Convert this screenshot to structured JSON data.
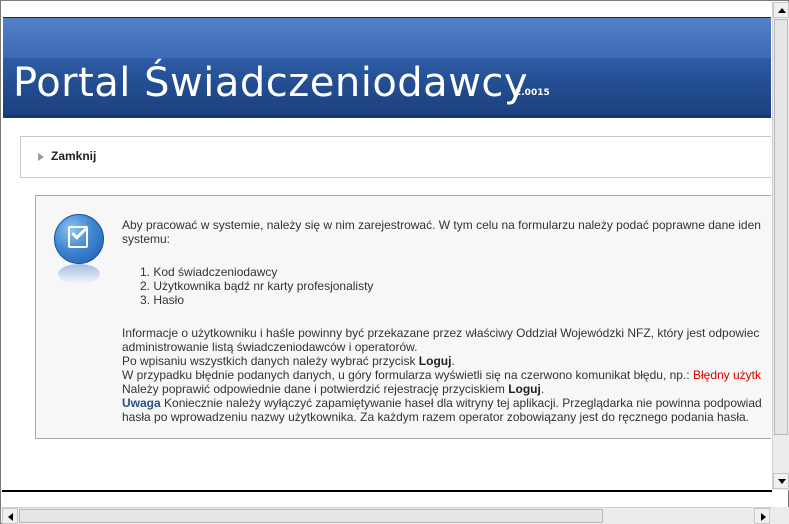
{
  "header": {
    "title": "Portal Świadczeniodawcy",
    "version": "2.0015"
  },
  "close_section": {
    "label": "Zamknij"
  },
  "info": {
    "intro_line1": "Aby pracować w systemie, należy się w nim zarejestrować. W tym celu na formularzu należy podać poprawne dane iden",
    "intro_line2": "systemu:",
    "list": [
      "1.   Kod świadczeniodawcy",
      "2.   Użytkownika bądź nr karty profesjonalisty",
      "3.   Hasło"
    ],
    "para1_line1": "Informacje o użytkowniku i haśle powinny być przekazane przez właściwy Oddział Wojewódzki NFZ, który jest odpowiec",
    "para1_line2": "administrowanie listą świadczeniodawców i operatorów.",
    "login_pre": "Po wpisaniu wszystkich danych należy wybrać przycisk ",
    "login_bold": "Loguj",
    "login_post": ".",
    "error_pre": "W przypadku błędnie podanych danych, u góry formularza wyświetli się na czerwono komunikat błędu, np.: ",
    "error_example": "Błędny użytk",
    "fix_pre": "Należy poprawić odpowiednie dane i potwierdzić rejestrację przyciskiem ",
    "fix_bold": "Loguj",
    "fix_post": ".",
    "warning_label": "Uwaga",
    "warning_line1": "  Koniecznie należy wyłączyć zapamiętywanie haseł dla witryny tej aplikacji. Przeglądarka nie powinna podpowiad",
    "warning_line2": "hasła po wprowadzeniu nazwy użytkownika. Za każdym razem operator zobowiązany jest do ręcznego podania hasła."
  },
  "colors": {
    "header_blue": "#234e93",
    "error_red": "#d40000",
    "warning_blue": "#2a4f86"
  },
  "icons": {
    "info_icon": "checklist-icon",
    "close_toggle": "triangle-right-icon"
  }
}
